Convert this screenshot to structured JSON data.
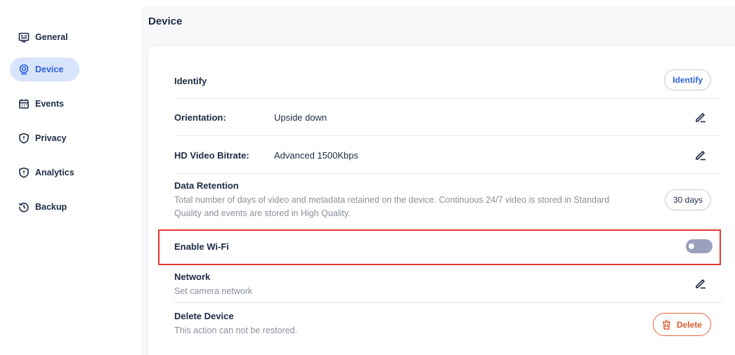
{
  "sidebar": {
    "items": [
      {
        "label": "General",
        "icon": "general-icon"
      },
      {
        "label": "Device",
        "icon": "device-icon",
        "active": true
      },
      {
        "label": "Events",
        "icon": "calendar-icon"
      },
      {
        "label": "Privacy",
        "icon": "shield-icon"
      },
      {
        "label": "Analytics",
        "icon": "shield-icon"
      },
      {
        "label": "Backup",
        "icon": "backup-icon"
      }
    ]
  },
  "page": {
    "title": "Device"
  },
  "settings": {
    "identify": {
      "title": "Identify",
      "button": "Identify"
    },
    "orientation": {
      "title": "Orientation:",
      "value": "Upside down"
    },
    "bitrate": {
      "title": "HD Video Bitrate:",
      "value": "Advanced 1500Kbps"
    },
    "retention": {
      "title": "Data Retention",
      "desc_line1": "Total number of days of video and metadata retained on the device. Continuous 24/7 video is stored in Standard",
      "desc_line2": "Quality and events are stored in High Quality.",
      "button": "30 days"
    },
    "wifi": {
      "title": "Enable Wi-Fi",
      "enabled": false
    },
    "network": {
      "title": "Network",
      "desc": "Set camera network"
    },
    "delete": {
      "title": "Delete Device",
      "desc": "This action can not be restored.",
      "button": "Delete"
    }
  },
  "colors": {
    "accent": "#2f62d6",
    "active_bg": "#d8e4fb",
    "danger": "#e05a31",
    "highlight": "#e53935",
    "toggle_off": "#9aa0bd"
  }
}
